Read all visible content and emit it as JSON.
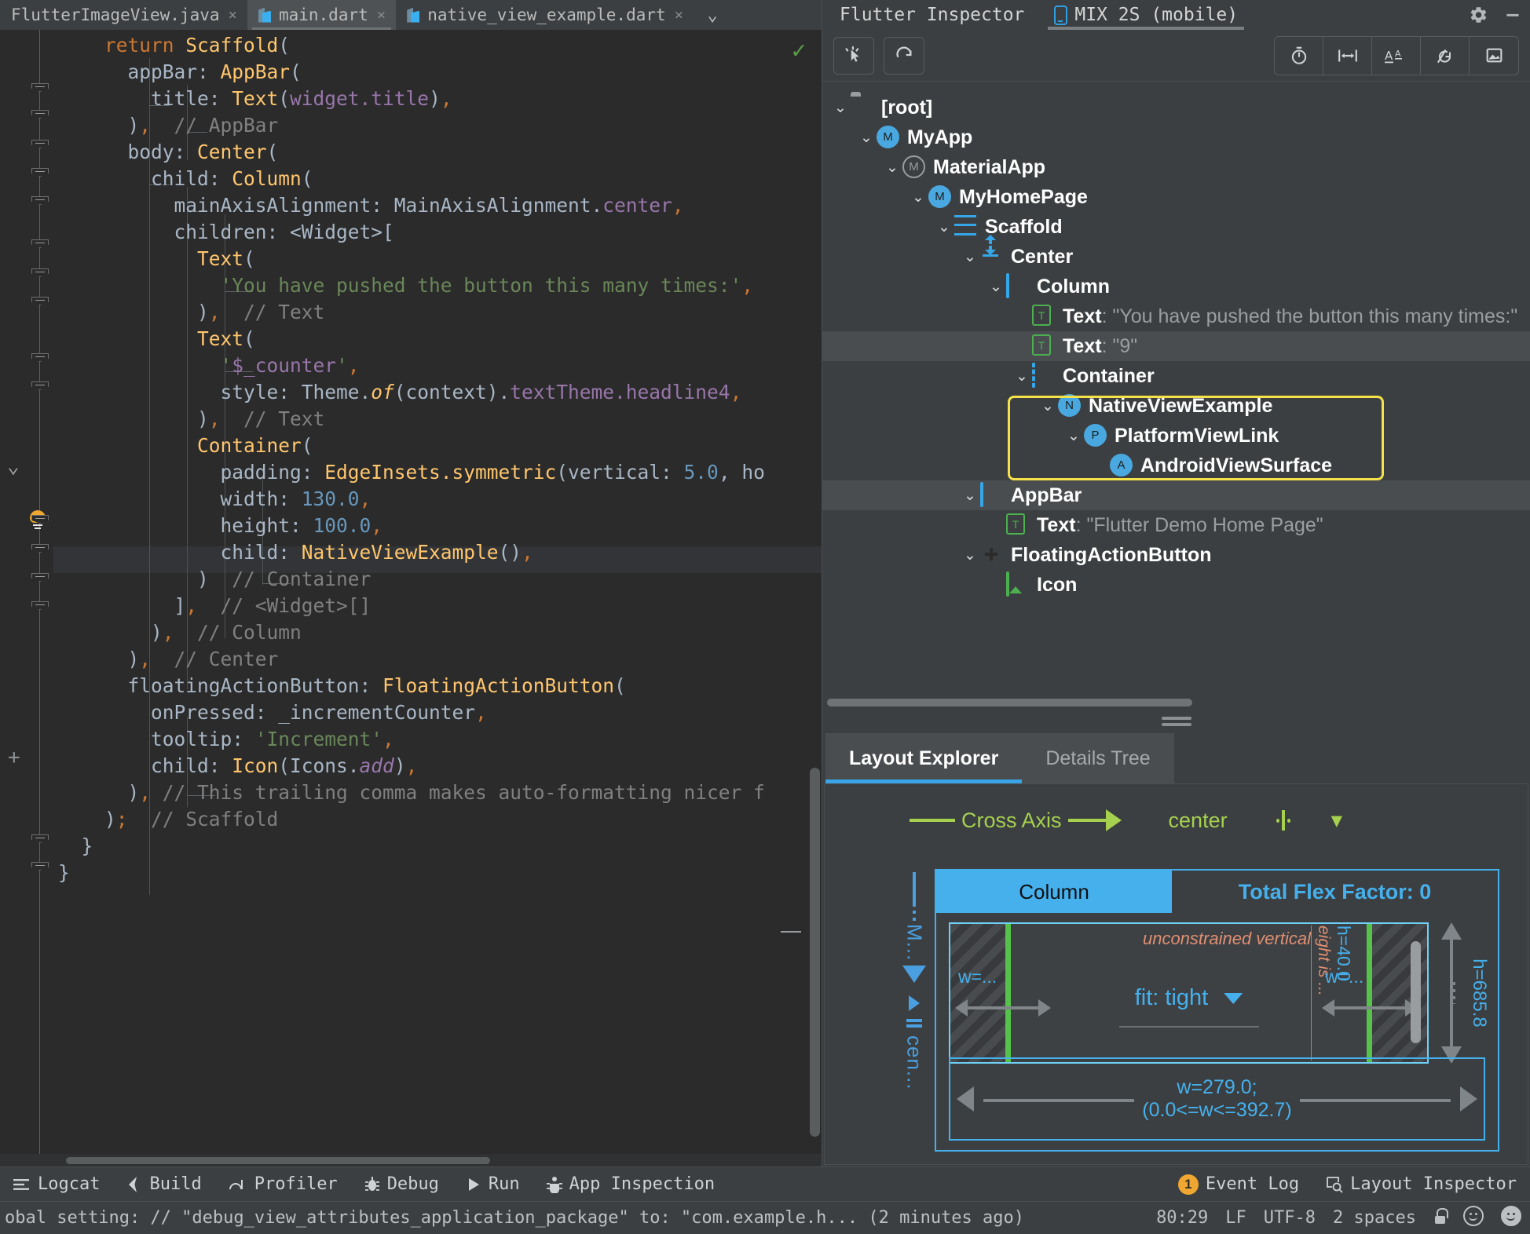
{
  "editor": {
    "tabs": [
      {
        "label": "FlutterImageView.java",
        "icon": "java-file-icon",
        "active": false,
        "close": "×"
      },
      {
        "label": "main.dart",
        "icon": "dart-file-icon",
        "active": true,
        "close": "×"
      },
      {
        "label": "native_view_example.dart",
        "icon": "dart-file-icon",
        "active": false,
        "close": "×"
      }
    ],
    "tab_overflow_icon": "chevron-down-icon",
    "inspection_status_icon": "check-ok-icon",
    "code_lines": [
      [
        {
          "t": "    return ",
          "c": "k"
        },
        {
          "t": "Scaffold",
          "c": "ty"
        },
        {
          "t": "(",
          "c": "pu"
        }
      ],
      [
        {
          "t": "      appBar: ",
          "c": "id"
        },
        {
          "t": "AppBar",
          "c": "ty"
        },
        {
          "t": "(",
          "c": "pu"
        }
      ],
      [
        {
          "t": "        title: ",
          "c": "id"
        },
        {
          "t": "Text",
          "c": "ty"
        },
        {
          "t": "(",
          "c": "pu"
        },
        {
          "t": "widget.title",
          "c": "fl"
        },
        {
          "t": ")",
          "c": "pu"
        },
        {
          "t": ",",
          "c": "cma"
        }
      ],
      [
        {
          "t": "      )",
          "c": "pu"
        },
        {
          "t": ",",
          "c": "cma"
        },
        {
          "t": "  // AppBar",
          "c": "cm"
        }
      ],
      [
        {
          "t": "      body: ",
          "c": "id"
        },
        {
          "t": "Center",
          "c": "ty"
        },
        {
          "t": "(",
          "c": "pu"
        }
      ],
      [
        {
          "t": "        child: ",
          "c": "id"
        },
        {
          "t": "Column",
          "c": "ty"
        },
        {
          "t": "(",
          "c": "pu"
        }
      ],
      [
        {
          "t": "          mainAxisAlignment: MainAxisAlignment.",
          "c": "id"
        },
        {
          "t": "center",
          "c": "fl"
        },
        {
          "t": ",",
          "c": "cma"
        }
      ],
      [
        {
          "t": "          children: <Widget>[",
          "c": "id"
        }
      ],
      [
        {
          "t": "            ",
          "c": "id"
        },
        {
          "t": "Text",
          "c": "ty"
        },
        {
          "t": "(",
          "c": "pu"
        }
      ],
      [
        {
          "t": "              'You have pushed the button this many times:'",
          "c": "st"
        },
        {
          "t": ",",
          "c": "cma"
        }
      ],
      [
        {
          "t": "            )",
          "c": "pu"
        },
        {
          "t": ",",
          "c": "cma"
        },
        {
          "t": "  // Text",
          "c": "cm"
        }
      ],
      [
        {
          "t": "            ",
          "c": "id"
        },
        {
          "t": "Text",
          "c": "ty"
        },
        {
          "t": "(",
          "c": "pu"
        }
      ],
      [
        {
          "t": "              '",
          "c": "st"
        },
        {
          "t": "$_counter",
          "c": "fl"
        },
        {
          "t": "'",
          "c": "st"
        },
        {
          "t": ",",
          "c": "cma"
        }
      ],
      [
        {
          "t": "              style: Theme.",
          "c": "id"
        },
        {
          "t": "of",
          "c": "ty itl"
        },
        {
          "t": "(context).",
          "c": "id"
        },
        {
          "t": "textTheme.headline4",
          "c": "fl"
        },
        {
          "t": ",",
          "c": "cma"
        }
      ],
      [
        {
          "t": "            )",
          "c": "pu"
        },
        {
          "t": ",",
          "c": "cma"
        },
        {
          "t": "  // Text",
          "c": "cm"
        }
      ],
      [
        {
          "t": "            ",
          "c": "id"
        },
        {
          "t": "Container",
          "c": "ty"
        },
        {
          "t": "(",
          "c": "pu"
        }
      ],
      [
        {
          "t": "              padding: ",
          "c": "id"
        },
        {
          "t": "EdgeInsets.symmetric",
          "c": "ty"
        },
        {
          "t": "(vertical: ",
          "c": "id"
        },
        {
          "t": "5.0",
          "c": "nu"
        },
        {
          "t": ", ho",
          "c": "id"
        }
      ],
      [
        {
          "t": "              width: ",
          "c": "id"
        },
        {
          "t": "130.0",
          "c": "nu"
        },
        {
          "t": ",",
          "c": "cma"
        }
      ],
      [
        {
          "t": "              height: ",
          "c": "id"
        },
        {
          "t": "100.0",
          "c": "nu"
        },
        {
          "t": ",",
          "c": "cma"
        }
      ],
      [
        {
          "t": "              child: ",
          "c": "id"
        },
        {
          "t": "NativeViewExample",
          "c": "ty"
        },
        {
          "t": "()",
          "c": "pu"
        },
        {
          "t": ",",
          "c": "cma"
        }
      ],
      [
        {
          "t": "            )",
          "c": "pu"
        },
        {
          "t": "  // Container",
          "c": "cm"
        }
      ],
      [
        {
          "t": "          ]",
          "c": "pu"
        },
        {
          "t": ",",
          "c": "cma"
        },
        {
          "t": "  // <Widget>[]",
          "c": "cm"
        }
      ],
      [
        {
          "t": "        )",
          "c": "pu"
        },
        {
          "t": ",",
          "c": "cma"
        },
        {
          "t": "  // Column",
          "c": "cm"
        }
      ],
      [
        {
          "t": "      )",
          "c": "pu"
        },
        {
          "t": ",",
          "c": "cma"
        },
        {
          "t": "  // Center",
          "c": "cm"
        }
      ],
      [
        {
          "t": "      floatingActionButton: ",
          "c": "id"
        },
        {
          "t": "FloatingActionButton",
          "c": "ty"
        },
        {
          "t": "(",
          "c": "pu"
        }
      ],
      [
        {
          "t": "        onPressed: _incrementCounter",
          "c": "id"
        },
        {
          "t": ",",
          "c": "cma"
        }
      ],
      [
        {
          "t": "        tooltip: ",
          "c": "id"
        },
        {
          "t": "'Increment'",
          "c": "st"
        },
        {
          "t": ",",
          "c": "cma"
        }
      ],
      [
        {
          "t": "        child: ",
          "c": "id"
        },
        {
          "t": "Icon",
          "c": "ty"
        },
        {
          "t": "(Icons.",
          "c": "id"
        },
        {
          "t": "add",
          "c": "fl itl"
        },
        {
          "t": ")",
          "c": "pu"
        },
        {
          "t": ",",
          "c": "cma"
        }
      ],
      [
        {
          "t": "      )",
          "c": "pu"
        },
        {
          "t": ",",
          "c": "cma"
        },
        {
          "t": " // This trailing comma makes auto-formatting nicer f",
          "c": "cm"
        }
      ],
      [
        {
          "t": "    )",
          "c": "pu"
        },
        {
          "t": ";",
          "c": "cma"
        },
        {
          "t": "  // Scaffold",
          "c": "cm"
        }
      ],
      [
        {
          "t": "  }",
          "c": "pu"
        }
      ],
      [
        {
          "t": "}",
          "c": "pu"
        }
      ]
    ]
  },
  "inspector": {
    "title": "Flutter Inspector",
    "device_tab": {
      "label": "MIX 2S (mobile)",
      "icon": "phone-icon"
    },
    "window_buttons": [
      {
        "name": "settings-gear",
        "icon": "gear-icon"
      },
      {
        "name": "minimize",
        "icon": "minimize-icon"
      }
    ],
    "toolbar_left": [
      {
        "name": "select-widget-mode",
        "icon": "cursor-select-icon"
      },
      {
        "name": "refresh-tree",
        "icon": "refresh-icon"
      }
    ],
    "toolbar_right": [
      {
        "name": "slow-animations",
        "icon": "stopwatch-icon"
      },
      {
        "name": "show-guidelines",
        "icon": "guidelines-icon"
      },
      {
        "name": "show-baselines",
        "icon": "baseline-AA-icon"
      },
      {
        "name": "highlight-repaints",
        "icon": "repaint-icon"
      },
      {
        "name": "highlight-oversized-images",
        "icon": "image-icon"
      }
    ],
    "tree": [
      {
        "label": "[root]",
        "value": "",
        "depth": 0,
        "icon": "folder-icon",
        "chevron": "down",
        "selected": false,
        "highlight": false
      },
      {
        "label": "MyApp",
        "value": "",
        "depth": 1,
        "icon": "circle-M-icon",
        "chevron": "down",
        "selected": false,
        "highlight": false
      },
      {
        "label": "MaterialApp",
        "value": "",
        "depth": 2,
        "icon": "circle-M-outline-icon",
        "chevron": "down",
        "selected": false,
        "highlight": false
      },
      {
        "label": "MyHomePage",
        "value": "",
        "depth": 3,
        "icon": "circle-M-icon",
        "chevron": "down",
        "selected": false,
        "highlight": false
      },
      {
        "label": "Scaffold",
        "value": "",
        "depth": 4,
        "icon": "scaffold-icon",
        "chevron": "down",
        "selected": false,
        "highlight": false
      },
      {
        "label": "Center",
        "value": "",
        "depth": 5,
        "icon": "center-icon",
        "chevron": "down",
        "selected": false,
        "highlight": false
      },
      {
        "label": "Column",
        "value": "",
        "depth": 6,
        "icon": "column-icon",
        "chevron": "down",
        "selected": false,
        "highlight": false
      },
      {
        "label": "Text",
        "value": ": \"You have pushed the button this many times:\"",
        "depth": 7,
        "icon": "text-T-icon",
        "chevron": "none",
        "selected": false,
        "highlight": false
      },
      {
        "label": "Text",
        "value": ": \"9\"",
        "depth": 7,
        "icon": "text-T-icon",
        "chevron": "none",
        "selected": true,
        "highlight": false
      },
      {
        "label": "Container",
        "value": "",
        "depth": 7,
        "icon": "container-dashed-icon",
        "chevron": "down",
        "selected": false,
        "highlight": false
      },
      {
        "label": "NativeViewExample",
        "value": "",
        "depth": 8,
        "icon": "circle-N-icon",
        "chevron": "down",
        "selected": false,
        "highlight": true
      },
      {
        "label": "PlatformViewLink",
        "value": "",
        "depth": 9,
        "icon": "circle-P-icon",
        "chevron": "down",
        "selected": false,
        "highlight": true
      },
      {
        "label": "AndroidViewSurface",
        "value": "",
        "depth": 10,
        "icon": "circle-A-icon",
        "chevron": "none",
        "selected": false,
        "highlight": true
      },
      {
        "label": "AppBar",
        "value": "",
        "depth": 5,
        "icon": "appbar-icon",
        "chevron": "down",
        "selected": true,
        "highlight": false
      },
      {
        "label": "Text",
        "value": ": \"Flutter Demo Home Page\"",
        "depth": 6,
        "icon": "text-T-icon",
        "chevron": "none",
        "selected": false,
        "highlight": false
      },
      {
        "label": "FloatingActionButton",
        "value": "",
        "depth": 5,
        "icon": "fab-plus-icon",
        "chevron": "down",
        "selected": false,
        "highlight": false
      },
      {
        "label": "Icon",
        "value": "",
        "depth": 6,
        "icon": "image-green-icon",
        "chevron": "none",
        "selected": false,
        "highlight": false
      }
    ],
    "panel_tabs": [
      {
        "label": "Layout Explorer",
        "active": true
      },
      {
        "label": "Details Tree",
        "active": false
      }
    ],
    "layout_explorer": {
      "cross_axis_label": "Cross Axis",
      "cross_axis_alignment": "center",
      "cross_axis_dropdown_icon": "chevron-down-icon",
      "main_axis_label": "M...",
      "main_axis_alignment": "cen...",
      "widget_name": "Column",
      "total_flex_factor": "Total Flex Factor: 0",
      "child_unconstrained_note": "unconstrained vertical",
      "child_fit": "fit: tight",
      "child_fit_dropdown_icon": "chevron-down-icon",
      "child_height_note": "eight is ...",
      "child_height": "h=40.0",
      "child_width_left": "w=...",
      "child_width_right": "w=...",
      "parent_height": "h=685.8",
      "width_label_line1": "w=279.0;",
      "width_label_line2": "(0.0<=w<=392.7)"
    }
  },
  "toolwindows": [
    {
      "label": "Logcat",
      "icon": "logcat-icon"
    },
    {
      "label": "Build",
      "icon": "build-hammer-icon"
    },
    {
      "label": "Profiler",
      "icon": "profiler-icon"
    },
    {
      "label": "Debug",
      "icon": "debug-bug-icon"
    },
    {
      "label": "Run",
      "icon": "run-play-icon"
    },
    {
      "label": "App Inspection",
      "icon": "app-inspection-icon"
    }
  ],
  "toolwindows_right": [
    {
      "label": "Event Log",
      "icon": "event-log-icon",
      "badge": "1"
    },
    {
      "label": "Layout Inspector",
      "icon": "layout-inspector-icon",
      "badge": ""
    }
  ],
  "statusbar": {
    "message": "obal setting: // \"debug_view_attributes_application_package\" to: \"com.example.h... (2 minutes ago)",
    "caret": "80:29",
    "line_separator": "LF",
    "encoding": "UTF-8",
    "indent": "2 spaces",
    "lock_icon": "lock-icon",
    "face_icons": [
      "smiley-outline-icon",
      "smiley-filled-icon"
    ]
  },
  "colors": {
    "editor_bg": "#2b2b2b",
    "panel_bg": "#3c3f41",
    "accent_blue": "#45b0ec",
    "accent_green": "#a5d14f",
    "highlight_yellow": "#f5e14a",
    "selection": "#4a4d4f"
  }
}
